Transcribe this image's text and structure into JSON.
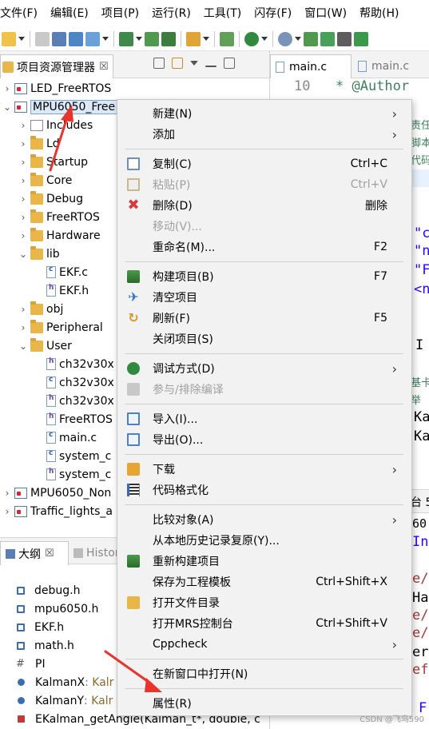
{
  "menubar": {
    "items": [
      "文件(F)",
      "编辑(E)",
      "项目(P)",
      "运行(R)",
      "工具(T)",
      "闪存(F)",
      "窗口(W)",
      "帮助(H)"
    ]
  },
  "project_explorer": {
    "tab_label": "项目资源管理器",
    "tab_close": "☒",
    "rows": [
      {
        "label": "LED_FreeRTOS",
        "arrow": "›",
        "icon": "project-icon"
      },
      {
        "label": "MPU6050_Free",
        "arrow": "⌄",
        "icon": "project-icon"
      },
      {
        "label": "Includes",
        "arrow": "›",
        "icon": "includes-icon"
      },
      {
        "label": "Ld",
        "arrow": "›",
        "icon": "folder-icon"
      },
      {
        "label": "Startup",
        "arrow": "›",
        "icon": "folder-icon"
      },
      {
        "label": "Core",
        "arrow": "›",
        "icon": "folder-icon"
      },
      {
        "label": "Debug",
        "arrow": "›",
        "icon": "folder-icon"
      },
      {
        "label": "FreeRTOS",
        "arrow": "›",
        "icon": "folder-icon"
      },
      {
        "label": "Hardware",
        "arrow": "›",
        "icon": "folder-icon"
      },
      {
        "label": "lib",
        "arrow": "⌄",
        "icon": "folder-icon"
      },
      {
        "label": "EKF.c",
        "arrow": "",
        "icon": "c-file-icon"
      },
      {
        "label": "EKF.h",
        "arrow": "",
        "icon": "h-file-icon"
      },
      {
        "label": "obj",
        "arrow": "›",
        "icon": "folder-icon"
      },
      {
        "label": "Peripheral",
        "arrow": "›",
        "icon": "folder-icon"
      },
      {
        "label": "User",
        "arrow": "⌄",
        "icon": "folder-icon"
      },
      {
        "label": "ch32v30x",
        "arrow": "",
        "icon": "h-file-icon"
      },
      {
        "label": "ch32v30x",
        "arrow": "",
        "icon": "c-file-icon"
      },
      {
        "label": "ch32v30x",
        "arrow": "",
        "icon": "h-file-icon"
      },
      {
        "label": "FreeRTOS",
        "arrow": "",
        "icon": "h-file-icon"
      },
      {
        "label": "main.c",
        "arrow": "",
        "icon": "c-file-icon"
      },
      {
        "label": "system_c",
        "arrow": "",
        "icon": "c-file-icon"
      },
      {
        "label": "system_c",
        "arrow": "",
        "icon": "h-file-icon"
      },
      {
        "label": "MPU6050_Non",
        "arrow": "›",
        "icon": "project-icon"
      },
      {
        "label": "Traffic_lights_a",
        "arrow": "›",
        "icon": "project-icon"
      }
    ]
  },
  "outline": {
    "tab_active": "大纲",
    "tab_close": "☒",
    "tab_inactive": "History",
    "rows": [
      {
        "label": "debug.h",
        "type": "",
        "icon": "include-icon"
      },
      {
        "label": "mpu6050.h",
        "type": "",
        "icon": "include-icon"
      },
      {
        "label": "EKF.h",
        "type": "",
        "icon": "include-icon"
      },
      {
        "label": "math.h",
        "type": "",
        "icon": "include-icon"
      },
      {
        "label": "PI",
        "type": "",
        "icon": "macro-icon"
      },
      {
        "label": "KalmanX",
        "type": " : Kalr",
        "icon": "variable-icon"
      },
      {
        "label": "KalmanY",
        "type": " : Kalr",
        "icon": "variable-icon"
      },
      {
        "label": "EKalman_getAngle(Kalman_t*, double, c",
        "type": "",
        "icon": "function-icon"
      }
    ]
  },
  "editor": {
    "tab_a": "main.c",
    "tab_b": "main.c",
    "line_number": "10",
    "line_text": "* @Author",
    "fragments": [
      "责任",
      "脚本",
      "代码",
      "\"c",
      "\"n",
      "\"F",
      "<n",
      "I",
      "基卡",
      "举",
      "Ka",
      "Ka"
    ],
    "console_tab": "台 5",
    "console_lines": [
      "60",
      "In",
      "e/:",
      "Ha",
      "e/:",
      "e/:",
      "er",
      "ef",
      "F"
    ]
  },
  "context_menu": {
    "items": [
      {
        "label": "新建(N)",
        "accel": "",
        "submenu": true,
        "disabled": false,
        "icon": ""
      },
      {
        "label": "添加",
        "accel": "",
        "submenu": true,
        "disabled": false,
        "icon": ""
      },
      {
        "sep": true
      },
      {
        "label": "复制(C)",
        "accel": "Ctrl+C",
        "submenu": false,
        "disabled": false,
        "icon": "copy-icon"
      },
      {
        "label": "粘贴(P)",
        "accel": "Ctrl+V",
        "submenu": false,
        "disabled": true,
        "icon": "paste-icon"
      },
      {
        "label": "删除(D)",
        "accel": "删除",
        "submenu": false,
        "disabled": false,
        "icon": "delete-icon"
      },
      {
        "label": "移动(V)...",
        "accel": "",
        "submenu": false,
        "disabled": true,
        "icon": ""
      },
      {
        "label": "重命名(M)...",
        "accel": "F2",
        "submenu": false,
        "disabled": false,
        "icon": ""
      },
      {
        "sep": true
      },
      {
        "label": "构建项目(B)",
        "accel": "F7",
        "submenu": false,
        "disabled": false,
        "icon": "build-icon"
      },
      {
        "label": "清空项目",
        "accel": "",
        "submenu": false,
        "disabled": false,
        "icon": "clean-icon"
      },
      {
        "label": "刷新(F)",
        "accel": "F5",
        "submenu": false,
        "disabled": false,
        "icon": "refresh-icon"
      },
      {
        "label": "关闭项目(S)",
        "accel": "",
        "submenu": false,
        "disabled": false,
        "icon": ""
      },
      {
        "sep": true
      },
      {
        "label": "调试方式(D)",
        "accel": "",
        "submenu": true,
        "disabled": false,
        "icon": "debug-icon"
      },
      {
        "label": "参与/排除编译",
        "accel": "",
        "submenu": false,
        "disabled": true,
        "icon": "exclude-icon"
      },
      {
        "sep": true
      },
      {
        "label": "导入(I)...",
        "accel": "",
        "submenu": false,
        "disabled": false,
        "icon": "import-icon"
      },
      {
        "label": "导出(O)...",
        "accel": "",
        "submenu": false,
        "disabled": false,
        "icon": "export-icon"
      },
      {
        "sep": true
      },
      {
        "label": "下载",
        "accel": "",
        "submenu": true,
        "disabled": false,
        "icon": "download-icon"
      },
      {
        "label": "代码格式化",
        "accel": "",
        "submenu": false,
        "disabled": false,
        "icon": "format-icon"
      },
      {
        "sep": true
      },
      {
        "label": "比较对象(A)",
        "accel": "",
        "submenu": true,
        "disabled": false,
        "icon": ""
      },
      {
        "label": "从本地历史记录复原(Y)...",
        "accel": "",
        "submenu": false,
        "disabled": false,
        "icon": ""
      },
      {
        "label": "重新构建项目",
        "accel": "",
        "submenu": false,
        "disabled": false,
        "icon": "rebuild-icon"
      },
      {
        "label": "保存为工程模板",
        "accel": "Ctrl+Shift+X",
        "submenu": false,
        "disabled": false,
        "icon": ""
      },
      {
        "label": "打开文件目录",
        "accel": "",
        "submenu": false,
        "disabled": false,
        "icon": "folder-icon"
      },
      {
        "label": "打开MRS控制台",
        "accel": "Ctrl+Shift+V",
        "submenu": false,
        "disabled": false,
        "icon": ""
      },
      {
        "label": "Cppcheck",
        "accel": "",
        "submenu": true,
        "disabled": false,
        "icon": ""
      },
      {
        "sep": true
      },
      {
        "label": "在新窗口中打开(N)",
        "accel": "",
        "submenu": false,
        "disabled": false,
        "icon": ""
      },
      {
        "sep": true
      },
      {
        "label": "属性(R)",
        "accel": "",
        "submenu": false,
        "disabled": false,
        "icon": ""
      }
    ]
  },
  "watermark": "CSDN @飞鸟590",
  "colors": {
    "annotation_red": "#e8342a",
    "menu_bg": "#f2f2f2",
    "selection": "#dbe8f8"
  }
}
